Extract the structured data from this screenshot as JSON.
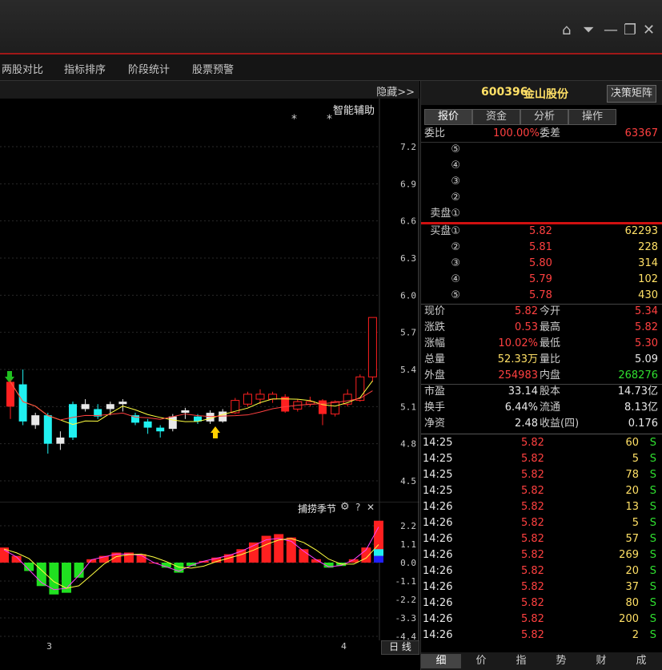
{
  "menu": [
    "两股对比",
    "指标排序",
    "阶段统计",
    "股票预警"
  ],
  "chart_top": {
    "hide_label": "隐藏>>",
    "assist_label": "智能辅助"
  },
  "main_yticks": [
    "7.2",
    "6.9",
    "6.6",
    "6.3",
    "6.0",
    "5.7",
    "5.4",
    "5.1",
    "4.8",
    "4.5"
  ],
  "sub_header": {
    "label": "捕捞季节"
  },
  "sub_yticks": [
    "2.2",
    "1.1",
    "0.0",
    "-1.1",
    "-2.2",
    "-3.3",
    "-4.4"
  ],
  "xaxis": {
    "labels": [
      "3",
      "4"
    ],
    "period_btn": "日 线"
  },
  "stock": {
    "code": "600396",
    "name": "金山股份",
    "decision_btn": "决策矩阵"
  },
  "panel_tabs": [
    "报价",
    "资金",
    "分析",
    "操作"
  ],
  "weibi": {
    "label": "委比",
    "value": "100.00%",
    "diff_label": "委差",
    "diff_value": "63367"
  },
  "sell_labels": [
    "⑤",
    "④",
    "③",
    "②",
    "卖盘①"
  ],
  "buy_orders": [
    {
      "label": "买盘①",
      "price": "5.82",
      "vol": "62293"
    },
    {
      "label": "②",
      "price": "5.81",
      "vol": "228"
    },
    {
      "label": "③",
      "price": "5.80",
      "vol": "314"
    },
    {
      "label": "④",
      "price": "5.79",
      "vol": "102"
    },
    {
      "label": "⑤",
      "price": "5.78",
      "vol": "430"
    }
  ],
  "quote": [
    {
      "l1": "现价",
      "v1": "5.82",
      "l2": "今开",
      "v2": "5.34"
    },
    {
      "l1": "涨跌",
      "v1": "0.53",
      "l2": "最高",
      "v2": "5.82"
    },
    {
      "l1": "涨幅",
      "v1": "10.02%",
      "l2": "最低",
      "v2": "5.30"
    },
    {
      "l1": "总量",
      "v1": "52.33万",
      "l2": "量比",
      "v2": "5.09"
    },
    {
      "l1": "外盘",
      "v1": "254983",
      "l2": "内盘",
      "v2": "268276"
    }
  ],
  "fundamentals": [
    {
      "l1": "市盈",
      "v1": "33.14",
      "l2": "股本",
      "v2": "14.73亿"
    },
    {
      "l1": "换手",
      "v1": "6.44%",
      "l2": "流通",
      "v2": "8.13亿"
    },
    {
      "l1": "净资",
      "v1": "2.48",
      "l2": "收益(四)",
      "v2": "0.176"
    }
  ],
  "ticks": [
    {
      "time": "14:25",
      "price": "5.82",
      "vol": "60",
      "side": "S"
    },
    {
      "time": "14:25",
      "price": "5.82",
      "vol": "5",
      "side": "S"
    },
    {
      "time": "14:25",
      "price": "5.82",
      "vol": "78",
      "side": "S"
    },
    {
      "time": "14:25",
      "price": "5.82",
      "vol": "20",
      "side": "S"
    },
    {
      "time": "14:26",
      "price": "5.82",
      "vol": "13",
      "side": "S"
    },
    {
      "time": "14:26",
      "price": "5.82",
      "vol": "5",
      "side": "S"
    },
    {
      "time": "14:26",
      "price": "5.82",
      "vol": "57",
      "side": "S"
    },
    {
      "time": "14:26",
      "price": "5.82",
      "vol": "269",
      "side": "S"
    },
    {
      "time": "14:26",
      "price": "5.82",
      "vol": "20",
      "side": "S"
    },
    {
      "time": "14:26",
      "price": "5.82",
      "vol": "37",
      "side": "S"
    },
    {
      "time": "14:26",
      "price": "5.82",
      "vol": "80",
      "side": "S"
    },
    {
      "time": "14:26",
      "price": "5.82",
      "vol": "200",
      "side": "S"
    },
    {
      "time": "14:26",
      "price": "5.82",
      "vol": "2",
      "side": "S"
    }
  ],
  "bottom_tabs": [
    "细",
    "价",
    "指",
    "势",
    "财",
    "成"
  ],
  "chart_data": [
    {
      "type": "candlestick",
      "ylim": [
        4.5,
        7.2
      ],
      "candles": [
        {
          "o": 5.1,
          "c": 5.3,
          "h": 5.32,
          "l": 5.0,
          "color": "red"
        },
        {
          "o": 5.28,
          "c": 4.98,
          "h": 5.4,
          "l": 4.95,
          "color": "cyan"
        },
        {
          "o": 4.95,
          "c": 5.03,
          "h": 5.05,
          "l": 4.92,
          "color": "white"
        },
        {
          "o": 5.03,
          "c": 4.8,
          "h": 5.05,
          "l": 4.72,
          "color": "cyan"
        },
        {
          "o": 4.8,
          "c": 4.85,
          "h": 4.9,
          "l": 4.75,
          "color": "white"
        },
        {
          "o": 4.85,
          "c": 5.12,
          "h": 5.14,
          "l": 4.83,
          "color": "cyan"
        },
        {
          "o": 5.08,
          "c": 5.12,
          "h": 5.16,
          "l": 5.06,
          "color": "white"
        },
        {
          "o": 5.08,
          "c": 5.02,
          "h": 5.12,
          "l": 5.0,
          "color": "cyan"
        },
        {
          "o": 5.08,
          "c": 5.12,
          "h": 5.14,
          "l": 5.03,
          "color": "white"
        },
        {
          "o": 5.12,
          "c": 5.14,
          "h": 5.16,
          "l": 5.06,
          "color": "white"
        },
        {
          "o": 5.03,
          "c": 4.97,
          "h": 5.05,
          "l": 4.95,
          "color": "cyan"
        },
        {
          "o": 4.98,
          "c": 4.93,
          "h": 5.0,
          "l": 4.88,
          "color": "cyan"
        },
        {
          "o": 4.93,
          "c": 4.9,
          "h": 4.95,
          "l": 4.85,
          "color": "cyan"
        },
        {
          "o": 4.92,
          "c": 5.02,
          "h": 5.04,
          "l": 4.9,
          "color": "white"
        },
        {
          "o": 5.05,
          "c": 5.07,
          "h": 5.09,
          "l": 5.0,
          "color": "white"
        },
        {
          "o": 5.02,
          "c": 4.98,
          "h": 5.04,
          "l": 4.96,
          "color": "cyan"
        },
        {
          "o": 4.98,
          "c": 5.05,
          "h": 5.07,
          "l": 4.96,
          "color": "white"
        },
        {
          "o": 4.98,
          "c": 5.06,
          "h": 5.08,
          "l": 4.97,
          "color": "white"
        },
        {
          "o": 5.05,
          "c": 5.15,
          "h": 5.17,
          "l": 5.04,
          "color": "redhollow"
        },
        {
          "o": 5.12,
          "c": 5.2,
          "h": 5.22,
          "l": 5.1,
          "color": "redhollow"
        },
        {
          "o": 5.16,
          "c": 5.2,
          "h": 5.24,
          "l": 5.12,
          "color": "redhollow"
        },
        {
          "o": 5.16,
          "c": 5.2,
          "h": 5.22,
          "l": 5.13,
          "color": "redhollow"
        },
        {
          "o": 5.18,
          "c": 5.06,
          "h": 5.2,
          "l": 5.05,
          "color": "red"
        },
        {
          "o": 5.08,
          "c": 5.14,
          "h": 5.16,
          "l": 5.06,
          "color": "redhollow"
        },
        {
          "o": 5.12,
          "c": 5.14,
          "h": 5.18,
          "l": 5.1,
          "color": "redhollow"
        },
        {
          "o": 5.15,
          "c": 5.04,
          "h": 5.16,
          "l": 4.95,
          "color": "red"
        },
        {
          "o": 5.04,
          "c": 5.14,
          "h": 5.15,
          "l": 5.02,
          "color": "redhollow"
        },
        {
          "o": 5.12,
          "c": 5.2,
          "h": 5.24,
          "l": 5.1,
          "color": "redhollow"
        },
        {
          "o": 5.15,
          "c": 5.34,
          "h": 5.36,
          "l": 5.14,
          "color": "redhollow"
        },
        {
          "o": 5.34,
          "c": 5.82,
          "h": 5.82,
          "l": 5.3,
          "color": "redhollow"
        }
      ]
    },
    {
      "type": "bar",
      "ylim": [
        -4.4,
        2.2
      ],
      "values": [
        0.9,
        0.4,
        -0.5,
        -1.4,
        -1.9,
        -1.8,
        -0.9,
        0.2,
        0.4,
        0.6,
        0.6,
        0.5,
        0.0,
        -0.3,
        -0.6,
        -0.2,
        0.1,
        0.3,
        0.5,
        0.8,
        1.2,
        1.6,
        1.7,
        1.5,
        0.8,
        0.2,
        -0.3,
        -0.2,
        0.2,
        0.9,
        2.5
      ]
    }
  ]
}
